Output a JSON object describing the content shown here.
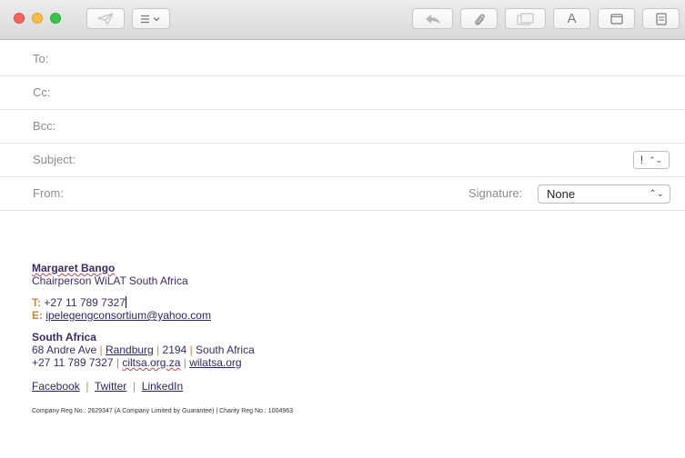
{
  "fields": {
    "to_label": "To:",
    "cc_label": "Cc:",
    "bcc_label": "Bcc:",
    "subject_label": "Subject:",
    "from_label": "From:",
    "priority_value": "!",
    "signature_label": "Signature:",
    "signature_value": "None"
  },
  "toolbar": {
    "format_label": "A"
  },
  "signature": {
    "name": "Margaret Bango",
    "title": "Chairperson WiLAT South Africa",
    "tel_label": "T:",
    "tel_value": "+27 11 789 7327",
    "email_label": "E:",
    "email_value": "ipelegengconsortium@yahoo.com",
    "region": "South Africa",
    "addr_street": "68 Andre Ave",
    "addr_city": "Randburg",
    "addr_code": "2194",
    "addr_country": "South Africa",
    "phone2": "+27 11 789 7327",
    "site1": "ciltsa.org.za",
    "site2": "wilatsa.org",
    "social": [
      "Facebook",
      "Twitter",
      "LinkedIn"
    ],
    "footer": "Company Reg No.: 2629347 (A Company Limited by Guarantee) | Charity Reg No.: 1004963"
  },
  "colors": {
    "name_color": "#3a2b66",
    "label_color": "#c5893a",
    "close": "#fc605c",
    "minimize": "#fdbc40",
    "zoom": "#34c84a"
  },
  "icons": [
    "send-icon",
    "header-fields-icon",
    "reply-icon",
    "attachment-icon",
    "photo-browser-icon",
    "format-icon",
    "window-icon",
    "stationery-icon"
  ]
}
